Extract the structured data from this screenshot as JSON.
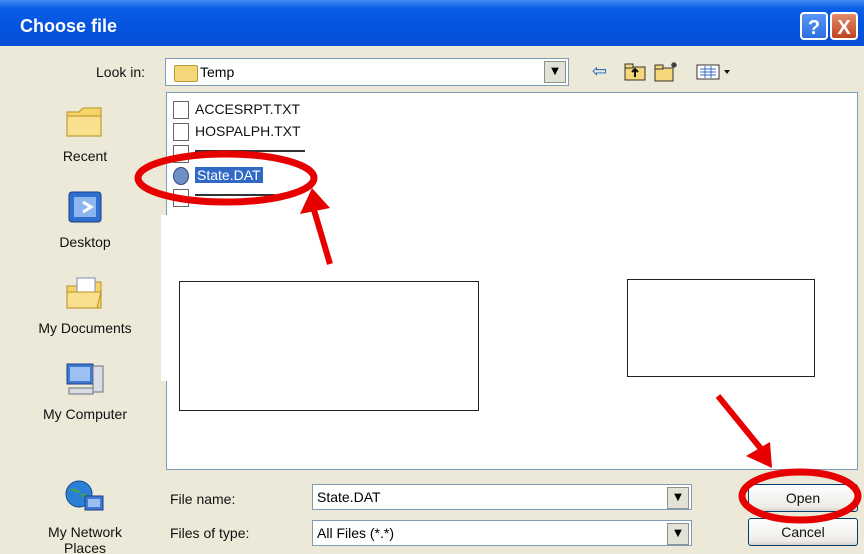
{
  "dialog": {
    "title": "Choose file",
    "help_glyph": "?",
    "close_glyph": "X"
  },
  "toolbar": {
    "look_in_label": "Look in:",
    "look_in_value": "Temp",
    "icons": [
      "back-arrow-icon",
      "up-folder-icon",
      "new-folder-icon",
      "views-menu-icon"
    ]
  },
  "places": [
    {
      "label": "Recent",
      "icon": "recent-folder-icon"
    },
    {
      "label": "Desktop",
      "icon": "desktop-icon"
    },
    {
      "label": "My Documents",
      "icon": "my-documents-icon"
    },
    {
      "label": "My Computer",
      "icon": "my-computer-icon"
    },
    {
      "label": "My Network\nPlaces",
      "icon": "network-places-icon"
    }
  ],
  "files": [
    {
      "name": "ACCESRPT.TXT",
      "selected": false
    },
    {
      "name": "HOSPALPH.TXT",
      "selected": false
    },
    {
      "name": "State.DAT",
      "selected": true
    }
  ],
  "form": {
    "file_name_label": "File name:",
    "file_name_value": "State.DAT",
    "files_of_type_label": "Files of type:",
    "files_of_type_value": "All Files (*.*)",
    "open_label": "Open",
    "cancel_label": "Cancel"
  },
  "annotation_color": "#E60000"
}
